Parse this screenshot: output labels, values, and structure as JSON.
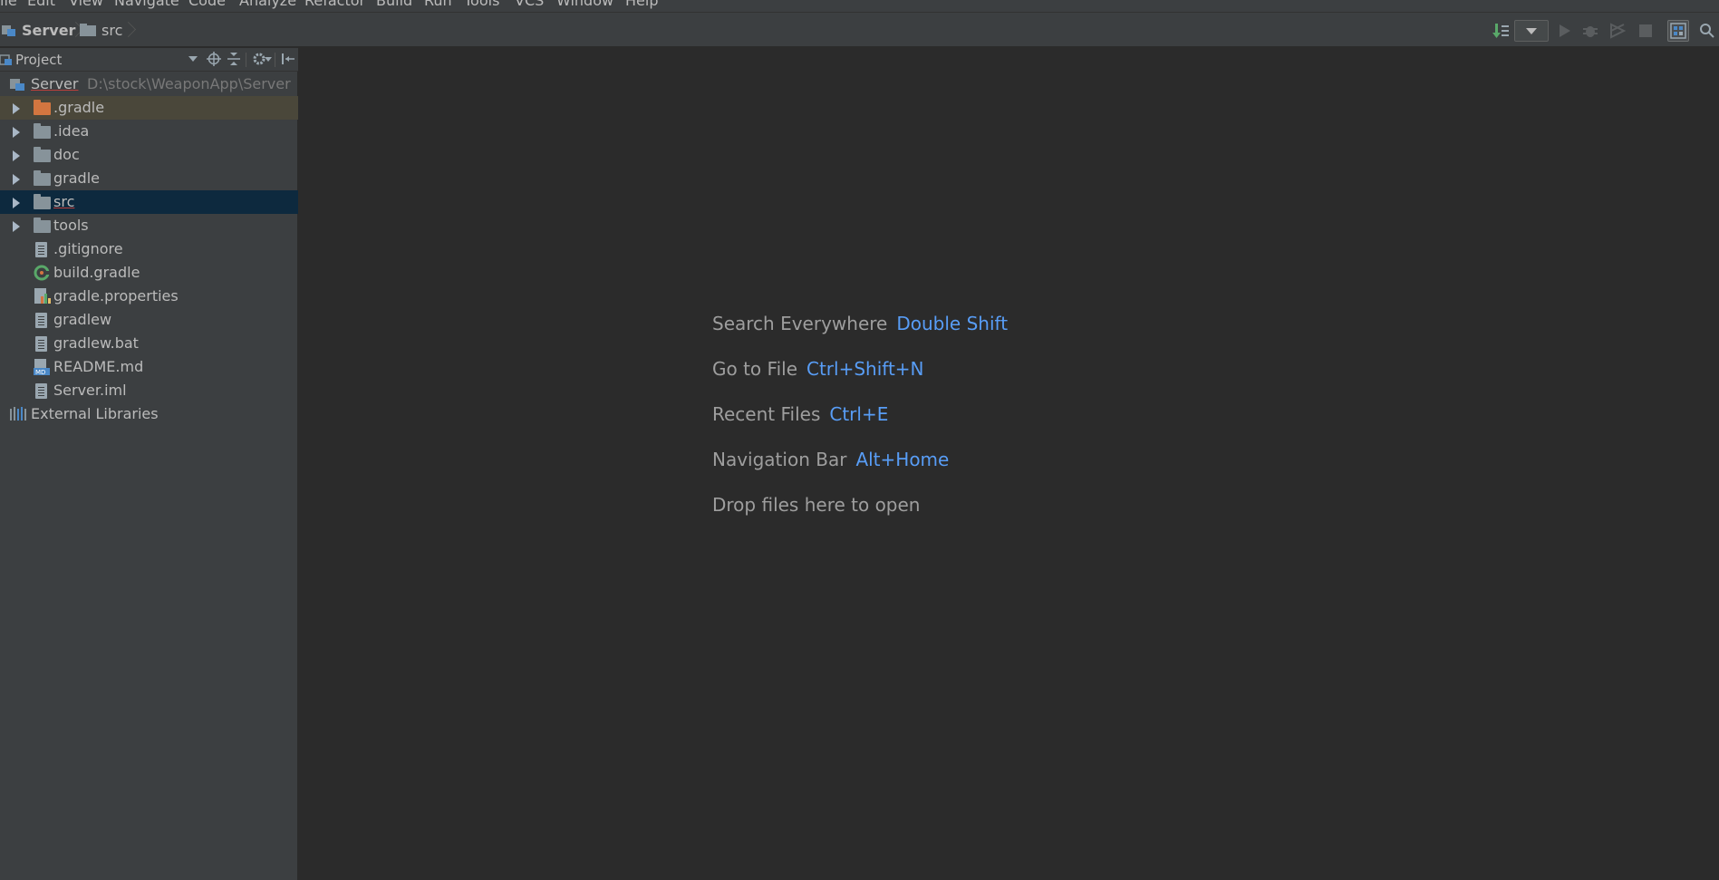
{
  "menu": {
    "items": [
      "ile",
      "Edit",
      "View",
      "Navigate",
      "Code",
      "Analyze",
      "Refactor",
      "Build",
      "Run",
      "Tools",
      "VCS",
      "Window",
      "Help"
    ]
  },
  "breadcrumb": {
    "project": "Server",
    "folder": "src"
  },
  "toolbar": {
    "icons": [
      "build-icon",
      "run-config-dropdown",
      "run-icon",
      "debug-icon",
      "coverage-icon",
      "stop-icon",
      "project-structure-icon",
      "search-icon"
    ]
  },
  "project_panel": {
    "title": "Project",
    "root": {
      "label": "Server",
      "path": "D:\\stock\\WeaponApp\\Server"
    },
    "items": [
      {
        "label": ".gradle",
        "type": "folder"
      },
      {
        "label": ".idea",
        "type": "folder"
      },
      {
        "label": "doc",
        "type": "folder"
      },
      {
        "label": "gradle",
        "type": "folder"
      },
      {
        "label": "src",
        "type": "folder"
      },
      {
        "label": "tools",
        "type": "folder"
      },
      {
        "label": ".gitignore",
        "type": "file"
      },
      {
        "label": "build.gradle",
        "type": "gradle"
      },
      {
        "label": "gradle.properties",
        "type": "properties"
      },
      {
        "label": "gradlew",
        "type": "file"
      },
      {
        "label": "gradlew.bat",
        "type": "file"
      },
      {
        "label": "README.md",
        "type": "markdown"
      },
      {
        "label": "Server.iml",
        "type": "file"
      }
    ],
    "external": "External Libraries"
  },
  "editor_hints": [
    {
      "text": "Search Everywhere",
      "key": "Double Shift"
    },
    {
      "text": "Go to File",
      "key": "Ctrl+Shift+N"
    },
    {
      "text": "Recent Files",
      "key": "Ctrl+E"
    },
    {
      "text": "Navigation Bar",
      "key": "Alt+Home"
    },
    {
      "text": "Drop files here to open",
      "key": ""
    }
  ],
  "colors": {
    "background": "#2b2b2b",
    "panel": "#3c3f41",
    "selection": "#0d293e",
    "shortcut": "#589df6",
    "folder": "#87939a",
    "gradle_folder": "#d37640"
  }
}
